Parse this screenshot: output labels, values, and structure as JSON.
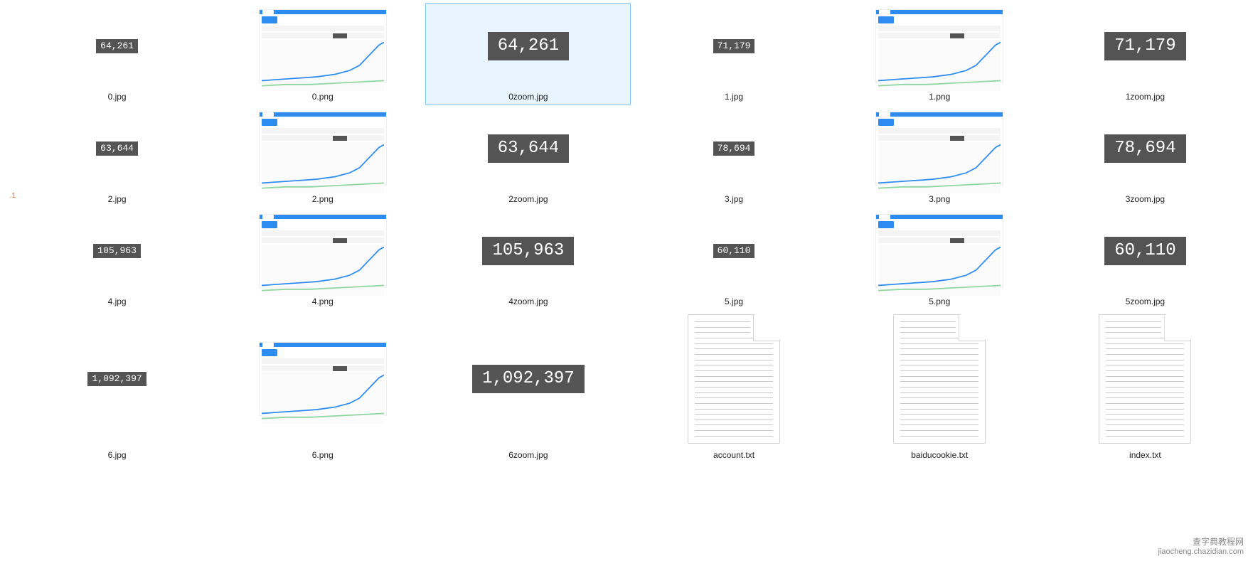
{
  "left_marker": ".1",
  "watermark": {
    "line1": "查字典教程网",
    "line2": "jiaocheng.chazidian.com"
  },
  "files": [
    {
      "name": "0.jpg",
      "type": "darksmall",
      "value": "64,261",
      "selected": false
    },
    {
      "name": "0.png",
      "type": "baidu",
      "value": "",
      "selected": false
    },
    {
      "name": "0zoom.jpg",
      "type": "darkbig",
      "value": "64,261",
      "selected": true
    },
    {
      "name": "1.jpg",
      "type": "darksmall",
      "value": "71,179",
      "selected": false
    },
    {
      "name": "1.png",
      "type": "baidu",
      "value": "",
      "selected": false
    },
    {
      "name": "1zoom.jpg",
      "type": "darkbig",
      "value": "71,179",
      "selected": false
    },
    {
      "name": "2.jpg",
      "type": "darksmall",
      "value": "63,644",
      "selected": false
    },
    {
      "name": "2.png",
      "type": "baidu",
      "value": "",
      "selected": false
    },
    {
      "name": "2zoom.jpg",
      "type": "darkbig",
      "value": "63,644",
      "selected": false
    },
    {
      "name": "3.jpg",
      "type": "darksmall",
      "value": "78,694",
      "selected": false
    },
    {
      "name": "3.png",
      "type": "baidu",
      "value": "",
      "selected": false
    },
    {
      "name": "3zoom.jpg",
      "type": "darkbig",
      "value": "78,694",
      "selected": false
    },
    {
      "name": "4.jpg",
      "type": "darksmall",
      "value": "105,963",
      "selected": false
    },
    {
      "name": "4.png",
      "type": "baidu",
      "value": "",
      "selected": false
    },
    {
      "name": "4zoom.jpg",
      "type": "darkbig",
      "value": "105,963",
      "selected": false
    },
    {
      "name": "5.jpg",
      "type": "darksmall",
      "value": "60,110",
      "selected": false
    },
    {
      "name": "5.png",
      "type": "baidu",
      "value": "",
      "selected": false
    },
    {
      "name": "5zoom.jpg",
      "type": "darkbig",
      "value": "60,110",
      "selected": false
    },
    {
      "name": "6.jpg",
      "type": "darksmall",
      "value": "1,092,397",
      "selected": false
    },
    {
      "name": "6.png",
      "type": "baidu",
      "value": "",
      "selected": false
    },
    {
      "name": "6zoom.jpg",
      "type": "darkbig",
      "value": "1,092,397",
      "selected": false
    },
    {
      "name": "account.txt",
      "type": "txt",
      "value": "",
      "selected": false
    },
    {
      "name": "baiducookie.txt",
      "type": "txt",
      "value": "",
      "selected": false
    },
    {
      "name": "index.txt",
      "type": "txt",
      "value": "",
      "selected": false
    }
  ]
}
